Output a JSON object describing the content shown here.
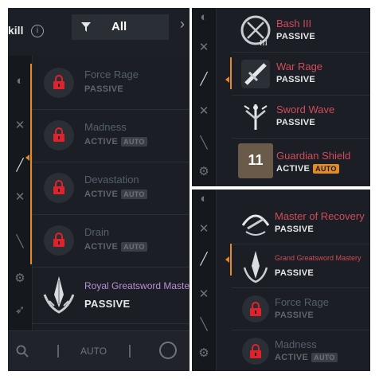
{
  "left_panel": {
    "header_title": "kill",
    "info_icon": "info-icon",
    "filter_label": "All",
    "filter_icon": "filter-icon",
    "bottom_label": "AUTO",
    "skills": [
      {
        "name": "Force Rage",
        "state": "PASSIVE",
        "locked": true
      },
      {
        "name": "Madness",
        "state": "ACTIVE",
        "badge": "AUTO",
        "locked": true
      },
      {
        "name": "Devastation",
        "state": "ACTIVE",
        "badge": "AUTO",
        "locked": true
      },
      {
        "name": "Drain",
        "state": "ACTIVE",
        "badge": "AUTO",
        "locked": true
      },
      {
        "name": "Royal Greatsword Master",
        "state": "PASSIVE",
        "locked": false,
        "title_color": "#b98fd6"
      }
    ]
  },
  "top_right_panel": {
    "skills": [
      {
        "name": "Bash III",
        "state": "PASSIVE",
        "title_color": "#d24b5a"
      },
      {
        "name": "War Rage",
        "state": "PASSIVE",
        "title_color": "#d24b5a"
      },
      {
        "name": "Sword Wave",
        "state": "PASSIVE",
        "title_color": "#d24b5a"
      },
      {
        "name": "Guardian Shield",
        "state": "ACTIVE",
        "badge": "AUTO",
        "cooldown": "11",
        "title_color": "#d24b5a"
      }
    ]
  },
  "bottom_right_panel": {
    "skills": [
      {
        "name": "Master of Recovery",
        "state": "PASSIVE",
        "title_color": "#d24b5a"
      },
      {
        "name": "Grand Greatsword Mastery",
        "state": "PASSIVE",
        "title_color": "#d24b5a"
      },
      {
        "name": "Force Rage",
        "state": "PASSIVE",
        "locked": true
      },
      {
        "name": "Madness",
        "state": "ACTIVE",
        "badge": "AUTO",
        "locked": true
      }
    ]
  },
  "colors": {
    "accent": "#e08a2a",
    "panel_bg": "#1b1e24",
    "skill_red": "#d24b5a",
    "skill_purple": "#b98fd6",
    "lock_red": "#e0222c"
  }
}
